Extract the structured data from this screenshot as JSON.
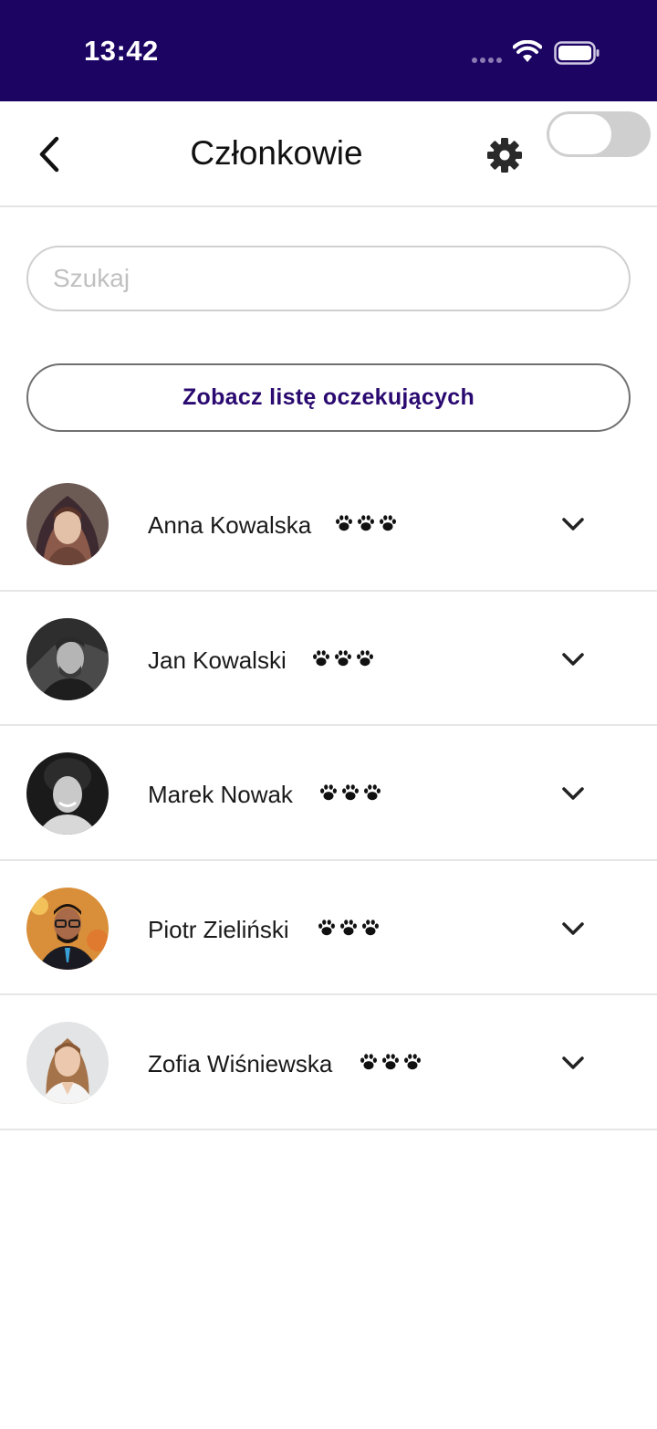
{
  "status_bar": {
    "time": "13:42",
    "background_color": "#1c0463",
    "icons": [
      "signal-dots-icon",
      "wifi-icon",
      "battery-icon"
    ]
  },
  "header": {
    "title": "Członkowie",
    "back_icon": "chevron-left-icon",
    "settings_icon": "gear-icon",
    "toggle_on": false
  },
  "search": {
    "placeholder": "Szukaj",
    "value": ""
  },
  "waitlist": {
    "label": "Zobacz listę oczekujących",
    "text_color": "#2a0a70"
  },
  "members": [
    {
      "name": "Anna Kowalska",
      "paws": 3
    },
    {
      "name": "Jan Kowalski",
      "paws": 3
    },
    {
      "name": "Marek Nowak",
      "paws": 3
    },
    {
      "name": "Piotr Zieliński",
      "paws": 3
    },
    {
      "name": "Zofia Wiśniewska",
      "paws": 3
    }
  ]
}
